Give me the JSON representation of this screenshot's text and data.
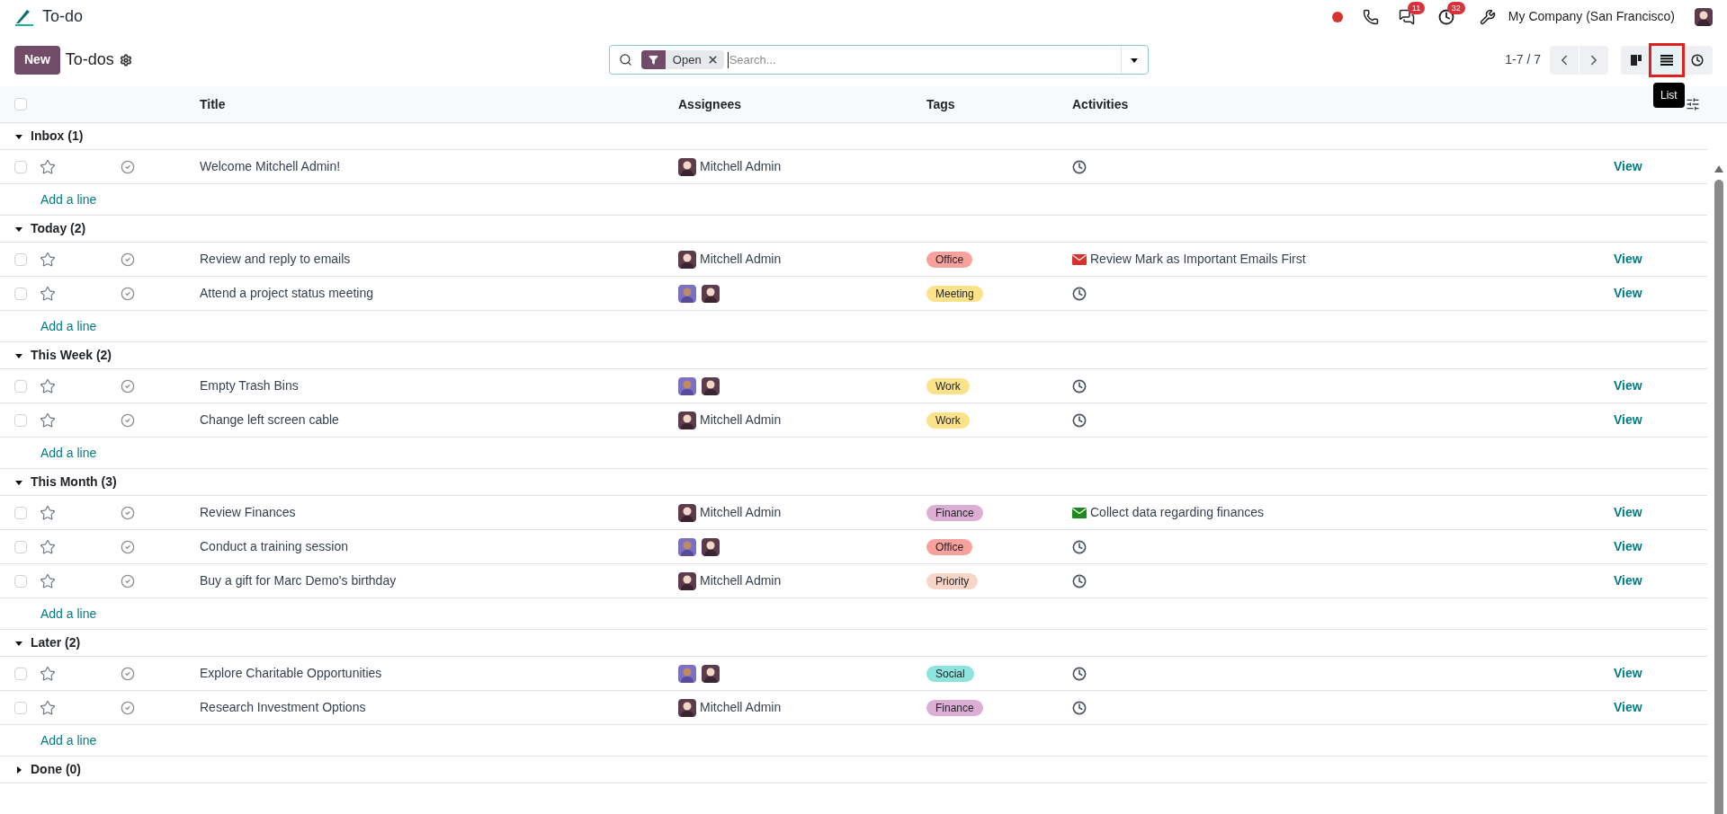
{
  "app": {
    "title": "To-do"
  },
  "systray": {
    "recording": true,
    "messages_badge": "11",
    "activities_badge": "32",
    "company": "My Company (San Francisco)"
  },
  "control_panel": {
    "new_button": "New",
    "breadcrumb": "To-dos",
    "facets": [
      {
        "label": "Open"
      }
    ],
    "search": {
      "placeholder": "Search..."
    },
    "pager": "1-7 / 7",
    "views": [
      {
        "kind": "kanban",
        "selected": false
      },
      {
        "kind": "list",
        "selected": true
      },
      {
        "kind": "activity",
        "selected": false
      }
    ],
    "tooltip": "List"
  },
  "table": {
    "select_all": {
      "checked": false
    },
    "columns": [
      "Title",
      "Assignees",
      "Tags",
      "Activities"
    ],
    "groups": [
      {
        "label": "Inbox (1)",
        "expanded": true,
        "add_line": "Add a line",
        "rows": [
          {
            "checked": false,
            "starred": false,
            "title": "Welcome Mitchell Admin!",
            "assignees": [
              {
                "kind": "glasses",
                "name": "Mitchell Admin"
              }
            ],
            "tags": [],
            "activity": {
              "kind": "clock"
            },
            "action": "View"
          }
        ]
      },
      {
        "label": "Today (2)",
        "expanded": true,
        "add_line": "Add a line",
        "rows": [
          {
            "checked": false,
            "starred": false,
            "title": "Review and reply to emails",
            "assignees": [
              {
                "kind": "glasses",
                "name": "Mitchell Admin"
              }
            ],
            "tags": [
              {
                "label": "Office",
                "color": "#f7a19c"
              }
            ],
            "activity": {
              "kind": "email",
              "color": "#d9312b",
              "summary": "Review Mark as Important Emails First"
            },
            "action": "View"
          },
          {
            "checked": false,
            "starred": false,
            "title": "Attend a project status meeting",
            "assignees": [
              {
                "kind": "beard"
              },
              {
                "kind": "glasses"
              }
            ],
            "tags": [
              {
                "label": "Meeting",
                "color": "#fce38a"
              }
            ],
            "activity": {
              "kind": "clock"
            },
            "action": "View"
          }
        ]
      },
      {
        "label": "This Week (2)",
        "expanded": true,
        "add_line": "Add a line",
        "rows": [
          {
            "checked": false,
            "starred": false,
            "title": "Empty Trash Bins",
            "assignees": [
              {
                "kind": "beard"
              },
              {
                "kind": "glasses"
              }
            ],
            "tags": [
              {
                "label": "Work",
                "color": "#fce38a"
              }
            ],
            "activity": {
              "kind": "clock"
            },
            "action": "View"
          },
          {
            "checked": false,
            "starred": false,
            "title": "Change left screen cable",
            "assignees": [
              {
                "kind": "glasses",
                "name": "Mitchell Admin"
              }
            ],
            "tags": [
              {
                "label": "Work",
                "color": "#fce38a"
              }
            ],
            "activity": {
              "kind": "clock"
            },
            "action": "View"
          }
        ]
      },
      {
        "label": "This Month (3)",
        "expanded": true,
        "add_line": "Add a line",
        "rows": [
          {
            "checked": false,
            "starred": false,
            "title": "Review Finances",
            "assignees": [
              {
                "kind": "glasses",
                "name": "Mitchell Admin"
              }
            ],
            "tags": [
              {
                "label": "Finance",
                "color": "#dcadd5"
              }
            ],
            "activity": {
              "kind": "email",
              "color": "#1e8a1e",
              "summary": "Collect data regarding finances"
            },
            "action": "View"
          },
          {
            "checked": false,
            "starred": false,
            "title": "Conduct a training session",
            "assignees": [
              {
                "kind": "beard"
              },
              {
                "kind": "glasses"
              }
            ],
            "tags": [
              {
                "label": "Office",
                "color": "#f7a19c"
              }
            ],
            "activity": {
              "kind": "clock"
            },
            "action": "View"
          },
          {
            "checked": false,
            "starred": false,
            "title": "Buy a gift for Marc Demo's birthday",
            "assignees": [
              {
                "kind": "glasses",
                "name": "Mitchell Admin"
              }
            ],
            "tags": [
              {
                "label": "Priority",
                "color": "#f7d6c8"
              }
            ],
            "activity": {
              "kind": "clock"
            },
            "action": "View"
          }
        ]
      },
      {
        "label": "Later (2)",
        "expanded": true,
        "add_line": "Add a line",
        "rows": [
          {
            "checked": false,
            "starred": false,
            "title": "Explore Charitable Opportunities",
            "assignees": [
              {
                "kind": "beard"
              },
              {
                "kind": "glasses"
              }
            ],
            "tags": [
              {
                "label": "Social",
                "color": "#8ee3dc"
              }
            ],
            "activity": {
              "kind": "clock"
            },
            "action": "View"
          },
          {
            "checked": false,
            "starred": false,
            "title": "Research Investment Options",
            "assignees": [
              {
                "kind": "glasses",
                "name": "Mitchell Admin"
              }
            ],
            "tags": [
              {
                "label": "Finance",
                "color": "#dcadd5"
              }
            ],
            "activity": {
              "kind": "clock"
            },
            "action": "View"
          }
        ]
      },
      {
        "label": "Done (0)",
        "expanded": false
      }
    ]
  }
}
